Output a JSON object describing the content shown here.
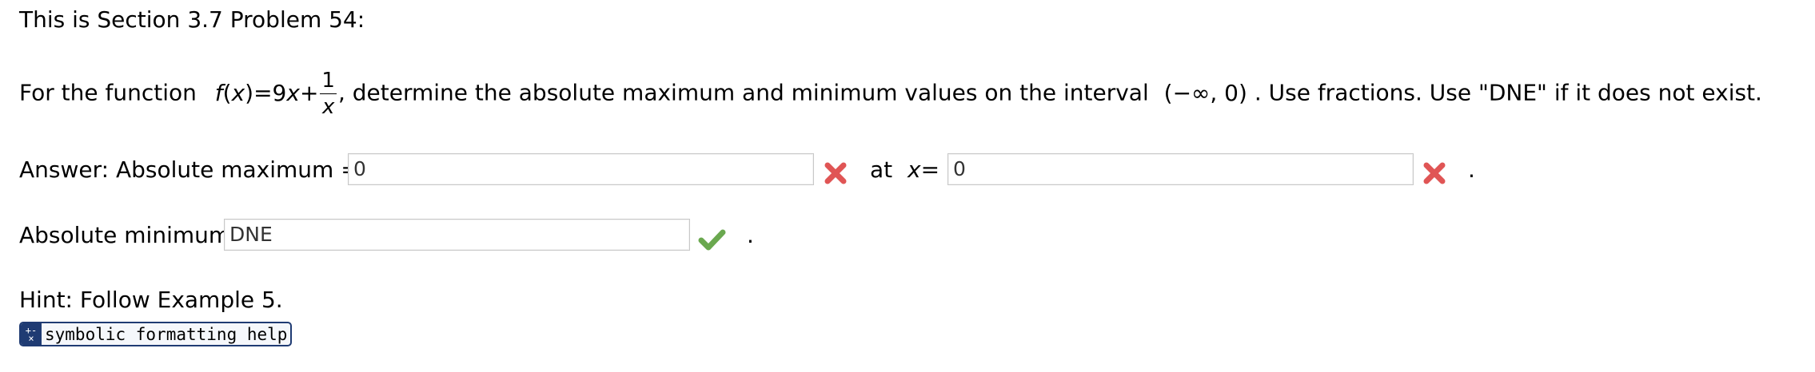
{
  "header": "This is Section 3.7 Problem 54:",
  "problem": {
    "prefix": "For the function",
    "func_name": "f",
    "var": "x",
    "func_mid": ")=9",
    "func_plus": "+",
    "frac_num": "1",
    "frac_den": "x",
    "suffix": ", determine the absolute maximum and minimum values on the interval",
    "interval": "(−∞, 0)",
    "instructions": ". Use fractions. Use \"DNE\" if it does not exist."
  },
  "answer_max": {
    "label": "Answer: Absolute maximum =",
    "value": "0",
    "status": "incorrect",
    "at_label": "at",
    "at_var": "x",
    "at_eq": "=",
    "at_value": "0",
    "at_status": "incorrect",
    "end": "."
  },
  "answer_min": {
    "label": "Absolute minimum",
    "value": "DNE",
    "status": "correct",
    "end": "."
  },
  "hint": "Hint: Follow Example 5.",
  "help_button": {
    "label": "symbolic formatting help",
    "icon": "formatting-help-icon"
  },
  "colors": {
    "incorrect": "#e05555",
    "correct": "#6aa84f",
    "help_button": "#1f3b73"
  }
}
